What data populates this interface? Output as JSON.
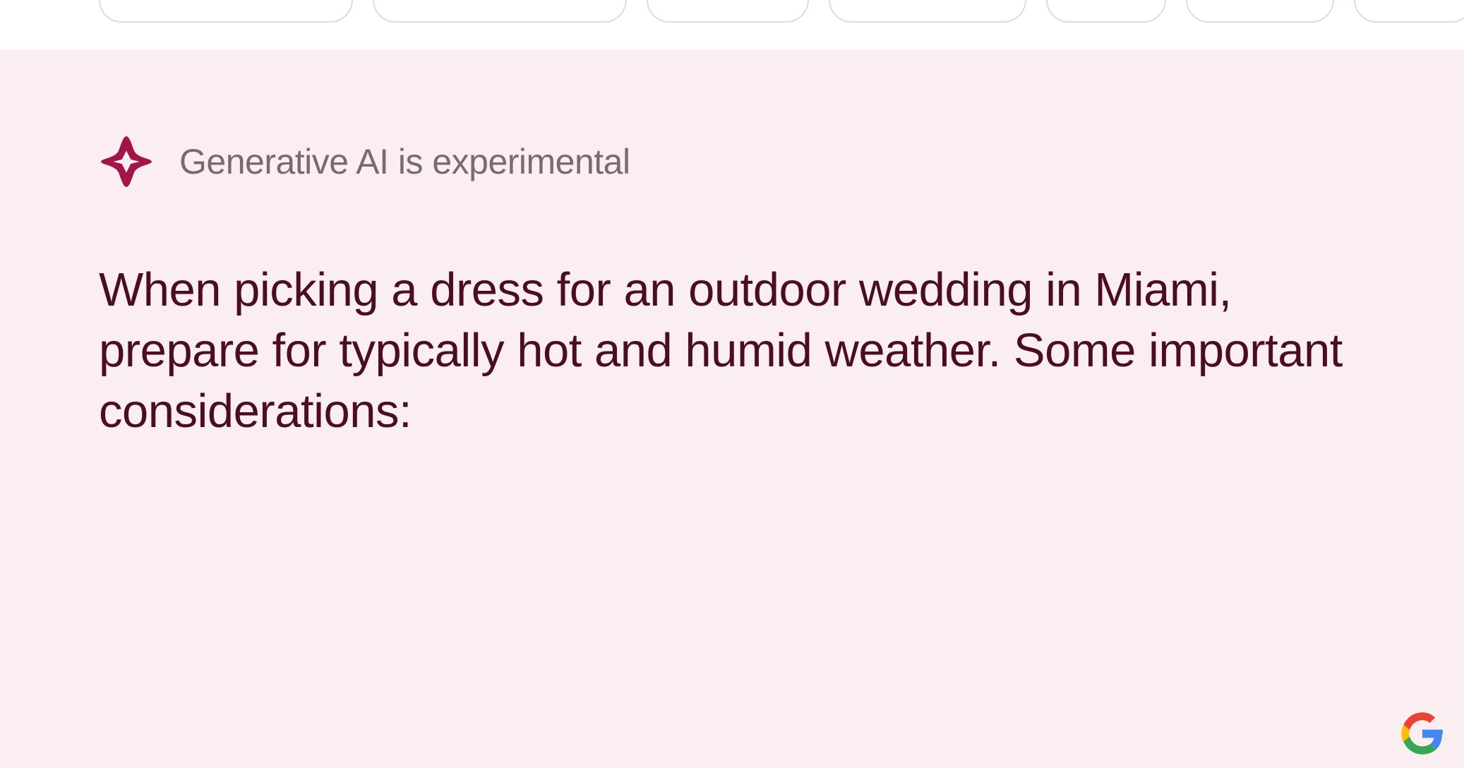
{
  "header": {
    "label": "Generative AI is experimental"
  },
  "body": {
    "text": "When picking a dress for an outdoor wedding in Miami, prepare for typically hot and humid weather.  Some important considerations:"
  },
  "chips": [
    {
      "id": "chip-1"
    },
    {
      "id": "chip-2"
    },
    {
      "id": "chip-3"
    },
    {
      "id": "chip-4"
    },
    {
      "id": "chip-5"
    },
    {
      "id": "chip-6"
    },
    {
      "id": "chip-7"
    }
  ],
  "colors": {
    "panel_bg": "#fbeef1",
    "sparkle": "#a3154a",
    "body_text": "#4a0e1e",
    "header_text": "#7a6a6d"
  }
}
